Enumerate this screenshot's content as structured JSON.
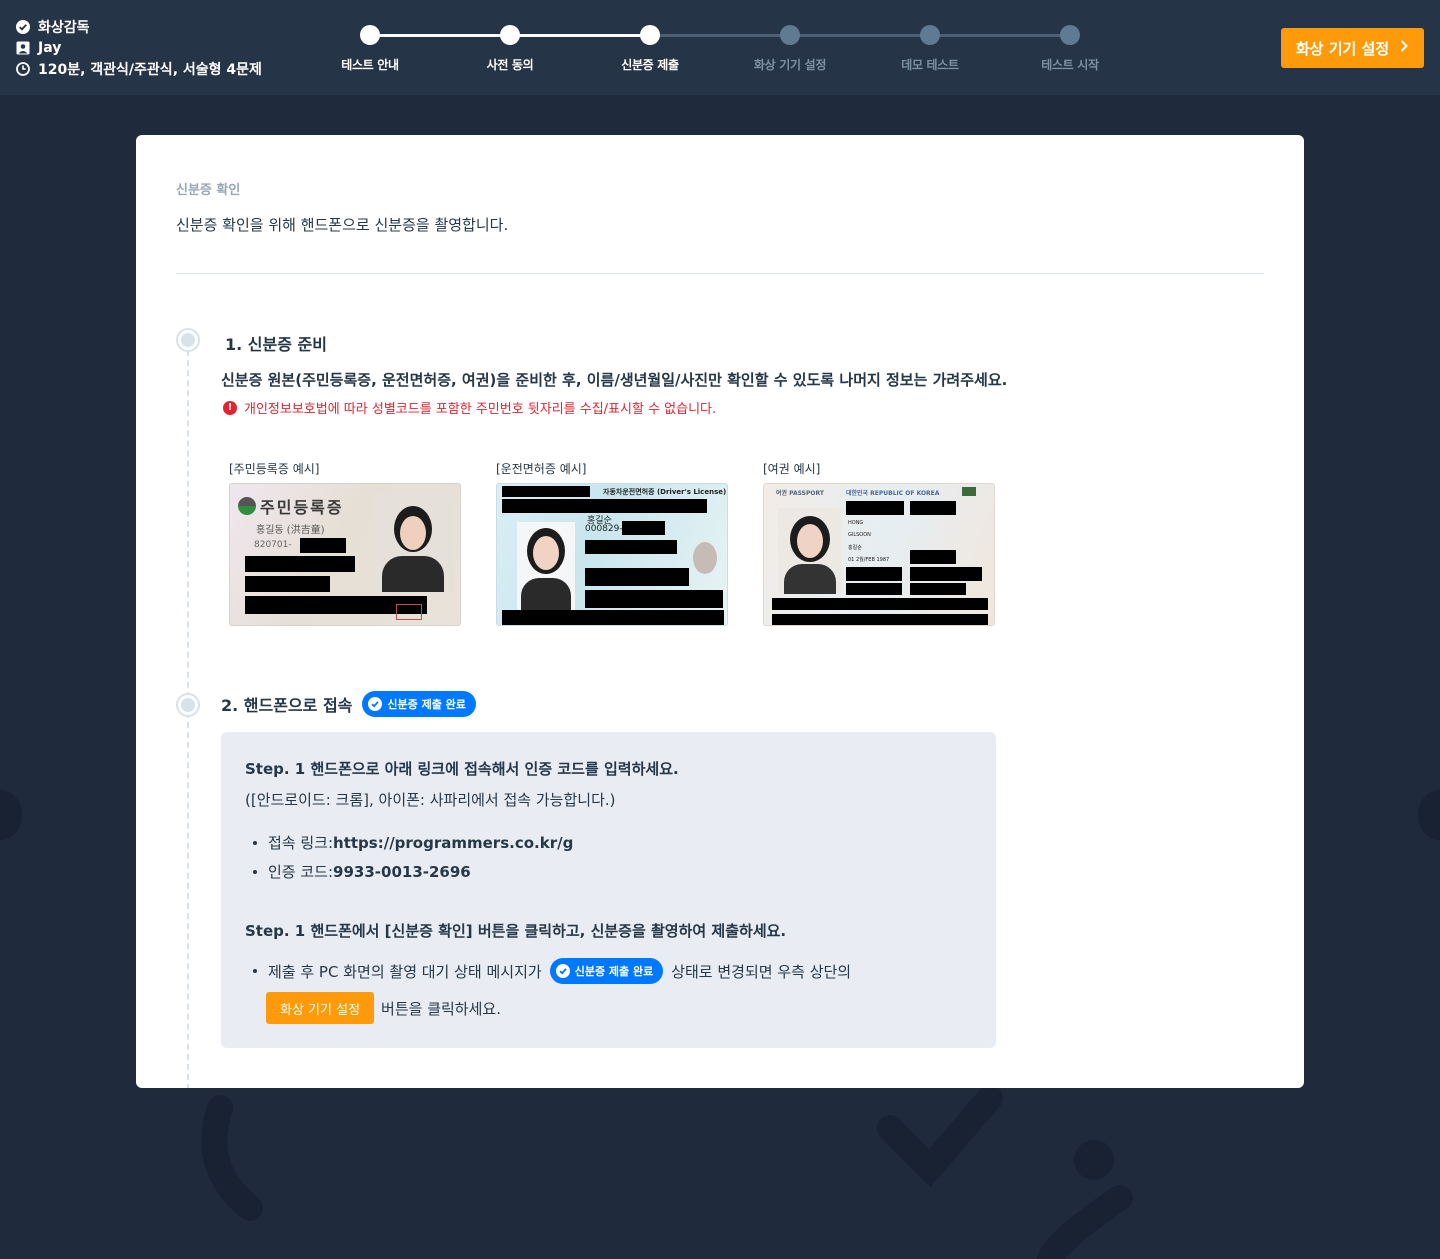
{
  "header": {
    "monitor_type": "화상감독",
    "user_name": "Jay",
    "test_info": "120분, 객관식/주관식, 서술형 4문제",
    "steps": [
      {
        "label": "테스트 안내",
        "done": true
      },
      {
        "label": "사전 동의",
        "done": true
      },
      {
        "label": "신분증 제출",
        "done": true
      },
      {
        "label": "화상 기기 설정",
        "done": false
      },
      {
        "label": "데모 테스트",
        "done": false
      },
      {
        "label": "테스트 시작",
        "done": false
      }
    ],
    "next_button": "화상 기기 설정",
    "colors": {
      "accent": "#ff9b0a",
      "done": "#ffffff",
      "todo": "#5f7a91"
    }
  },
  "card": {
    "subtitle": "신분증 확인",
    "description": "신분증 확인을 위해 핸드폰으로 신분증을 촬영합니다.",
    "section1": {
      "title": "1. 신분증 준비",
      "text": "신분증 원본(주민등록증, 운전면허증, 여권)을 준비한 후, 이름/생년월일/사진만 확인할 수 있도록 나머지 정보는 가려주세요.",
      "warning": "개인정보보호법에 따라 성별코드를 포함한 주민번호 뒷자리를 수집/표시할 수 없습니다.",
      "samples": [
        {
          "label": "[주민등록증 예시]",
          "card_title": "주민등록증",
          "name": "홍길동 (洪吉童)",
          "number": "820701-"
        },
        {
          "label": "[운전면허증 예시]",
          "card_title": "자동차운전면허증 (Driver's License)",
          "name": "홍길순",
          "number": "000829-"
        },
        {
          "label": "[여권 예시]",
          "card_title": "여권 PASSPORT",
          "country": "대한민국 REPUBLIC OF KOREA",
          "surname": "HONG",
          "given_name": "GILSOON",
          "name": "홍길순",
          "birth": "01 2월/FEB 1987"
        }
      ]
    },
    "section2": {
      "title": "2. 핸드폰으로 접속",
      "badge": "신분증 제출 완료",
      "step1_title": "Step. 1 핸드폰으로 아래 링크에 접속해서 인증 코드를 입력하세요.",
      "step1_note": "([안드로이드: 크롬], 아이폰: 사파리에서 접속 가능합니다.)",
      "link_label": "접속 링크: ",
      "link_value": "https://programmers.co.kr/g",
      "code_label": "인증 코드: ",
      "code_value": "9933-0013-2696",
      "step2_title": "Step. 1 핸드폰에서 [신분증 확인] 버튼을 클릭하고, 신분증을 촬영하여 제출하세요.",
      "step2_text_before": "제출 후 PC 화면의 촬영 대기 상태 메시지가",
      "step2_badge": "신분증 제출 완료",
      "step2_text_after": "상태로 변경되면 우측 상단의",
      "step2_button": "화상 기기 설정",
      "step2_text_end": "버튼을 클릭하세요."
    }
  }
}
